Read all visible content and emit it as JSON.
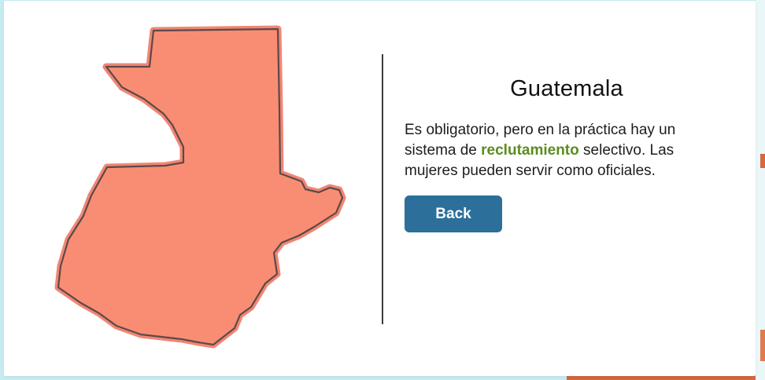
{
  "country": {
    "name": "Guatemala",
    "map_label": "guatemala-map",
    "map_fill": "#f98d73",
    "map_glow": "#f0705a",
    "map_stroke": "#5b4a4a"
  },
  "description": {
    "part1": "Es obligatorio, pero en la práctica hay un sistema de ",
    "highlight": "reclutamiento",
    "part2": " selectivo. Las mujeres pueden servir como oficiales.",
    "highlight_color": "#5a8d1f"
  },
  "actions": {
    "back_label": "Back",
    "back_color": "#2b6f9a"
  }
}
